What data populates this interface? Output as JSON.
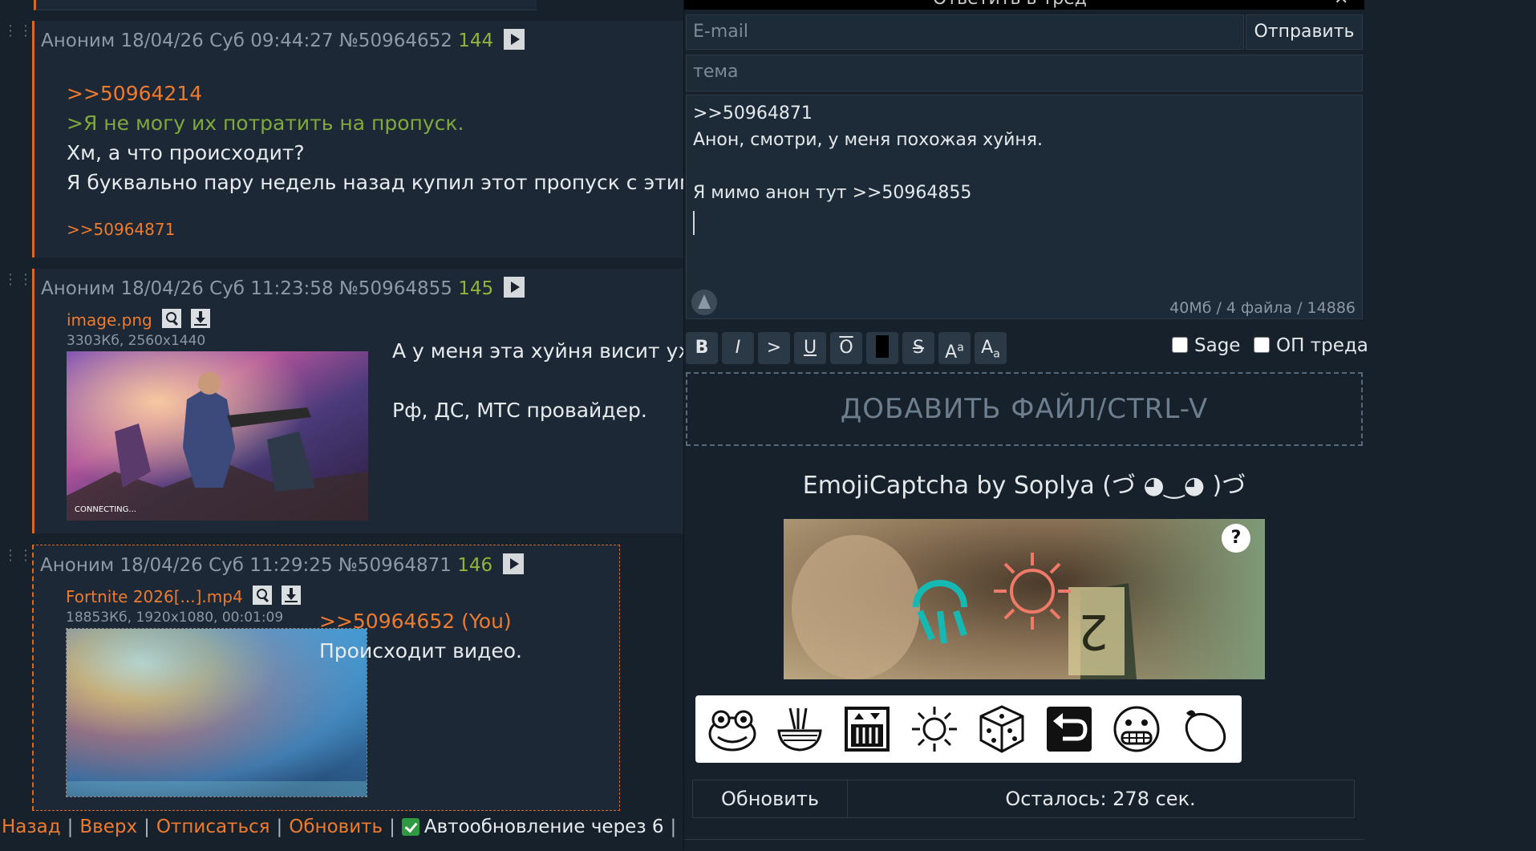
{
  "thread": {
    "posts": [
      {
        "author": "Аноним",
        "datetime": "18/04/26 Суб 09:44:27",
        "id": "№50964652",
        "number": "144",
        "lines": [
          {
            "text": ">>50964214",
            "kind": "link"
          },
          {
            "text": ">Я не могу их потратить на пропуск.",
            "kind": "quote"
          },
          {
            "text": "Хм, а что происходит?",
            "kind": "text"
          },
          {
            "text": "Я буквально пару недель назад купил этот пропуск с этим",
            "kind": "text"
          }
        ],
        "reply_link": ">>50964871"
      },
      {
        "author": "Аноним",
        "datetime": "18/04/26 Суб 11:23:58",
        "id": "№50964855",
        "number": "145",
        "file_name": "image.png",
        "file_meta": "3303Кб, 2560x1440",
        "thumb_caption": "CONNECTING...",
        "lines": [
          {
            "text": "А у меня эта хуйня висит уж",
            "kind": "text"
          },
          {
            "text": "Рф, ДС, МТС провайдер.",
            "kind": "text"
          }
        ]
      },
      {
        "author": "Аноним",
        "datetime": "18/04/26 Суб 11:29:25",
        "id": "№50964871",
        "number": "146",
        "file_name": "Fortnite 2026[...].mp4",
        "file_meta": "18853Кб, 1920x1080, 00:01:09",
        "lines": [
          {
            "text": ">>50964652 (You)",
            "kind": "link"
          },
          {
            "text": "Происходит видео.",
            "kind": "text"
          }
        ]
      }
    ],
    "bottom_nav": {
      "back": "Назад",
      "up": "Вверх",
      "unsubscribe": "Отписаться",
      "refresh": "Обновить",
      "autoupdate": "Автообновление через 6"
    }
  },
  "form": {
    "title": "Ответить в тред",
    "email_placeholder": "E-mail",
    "submit": "Отправить",
    "subject_placeholder": "тема",
    "message_lines": [
      ">>50964871",
      "Анон, смотри, у меня похожая хуйня.",
      "",
      "Я мимо анон тут >>50964855"
    ],
    "limits": "40Мб / 4 файла / 14886",
    "format_buttons": [
      "B",
      "I",
      ">",
      "U",
      "O",
      "",
      "S",
      "Aa",
      "Aa"
    ],
    "sage_label": "Sage",
    "op_label": "ОП треда",
    "dropzone": "ДОБАВИТЬ ФАЙЛ/CTRL-V",
    "captcha_title": "EmojiCaptcha by Soplya (づ ◕‿◕ )づ",
    "captcha_help": "?",
    "emoji_choices": [
      "frog-face",
      "ramen-bowl",
      "elevator",
      "sun",
      "game-die",
      "return-arrow",
      "grimacing-face",
      "lemon"
    ],
    "refresh": "Обновить",
    "timer": "Осталось: 278 сек."
  },
  "colors": {
    "accent_orange": "#ee7b2d",
    "greentext": "#80a93a",
    "post_number": "#90b43a",
    "background": "#17212b"
  }
}
